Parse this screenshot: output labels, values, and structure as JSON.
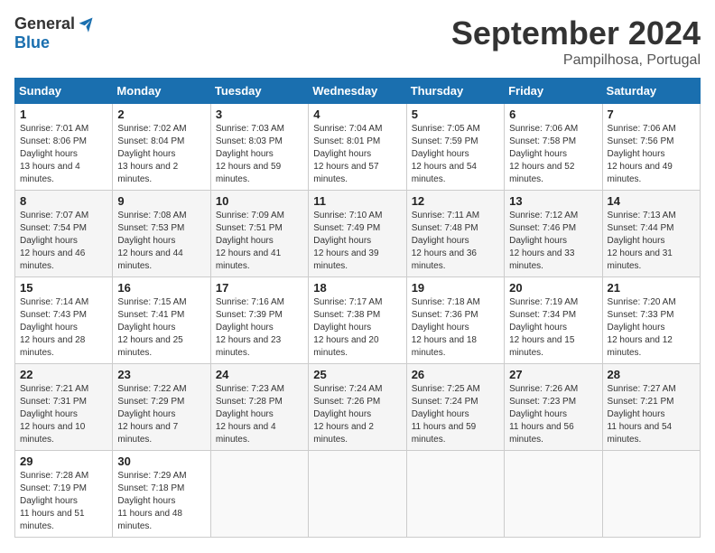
{
  "header": {
    "logo_general": "General",
    "logo_blue": "Blue",
    "month_title": "September 2024",
    "location": "Pampilhosa, Portugal"
  },
  "calendar": {
    "days_of_week": [
      "Sunday",
      "Monday",
      "Tuesday",
      "Wednesday",
      "Thursday",
      "Friday",
      "Saturday"
    ],
    "weeks": [
      [
        null,
        null,
        null,
        null,
        {
          "day": 1,
          "sunrise": "7:01 AM",
          "sunset": "8:06 PM",
          "daylight": "13 hours and 4 minutes."
        },
        {
          "day": 2,
          "sunrise": "7:02 AM",
          "sunset": "8:04 PM",
          "daylight": "13 hours and 2 minutes."
        },
        {
          "day": 3,
          "sunrise": "7:03 AM",
          "sunset": "8:03 PM",
          "daylight": "12 hours and 59 minutes."
        },
        {
          "day": 4,
          "sunrise": "7:04 AM",
          "sunset": "8:01 PM",
          "daylight": "12 hours and 57 minutes."
        },
        {
          "day": 5,
          "sunrise": "7:05 AM",
          "sunset": "7:59 PM",
          "daylight": "12 hours and 54 minutes."
        },
        {
          "day": 6,
          "sunrise": "7:06 AM",
          "sunset": "7:58 PM",
          "daylight": "12 hours and 52 minutes."
        },
        {
          "day": 7,
          "sunrise": "7:06 AM",
          "sunset": "7:56 PM",
          "daylight": "12 hours and 49 minutes."
        }
      ],
      [
        {
          "day": 8,
          "sunrise": "7:07 AM",
          "sunset": "7:54 PM",
          "daylight": "12 hours and 46 minutes."
        },
        {
          "day": 9,
          "sunrise": "7:08 AM",
          "sunset": "7:53 PM",
          "daylight": "12 hours and 44 minutes."
        },
        {
          "day": 10,
          "sunrise": "7:09 AM",
          "sunset": "7:51 PM",
          "daylight": "12 hours and 41 minutes."
        },
        {
          "day": 11,
          "sunrise": "7:10 AM",
          "sunset": "7:49 PM",
          "daylight": "12 hours and 39 minutes."
        },
        {
          "day": 12,
          "sunrise": "7:11 AM",
          "sunset": "7:48 PM",
          "daylight": "12 hours and 36 minutes."
        },
        {
          "day": 13,
          "sunrise": "7:12 AM",
          "sunset": "7:46 PM",
          "daylight": "12 hours and 33 minutes."
        },
        {
          "day": 14,
          "sunrise": "7:13 AM",
          "sunset": "7:44 PM",
          "daylight": "12 hours and 31 minutes."
        }
      ],
      [
        {
          "day": 15,
          "sunrise": "7:14 AM",
          "sunset": "7:43 PM",
          "daylight": "12 hours and 28 minutes."
        },
        {
          "day": 16,
          "sunrise": "7:15 AM",
          "sunset": "7:41 PM",
          "daylight": "12 hours and 25 minutes."
        },
        {
          "day": 17,
          "sunrise": "7:16 AM",
          "sunset": "7:39 PM",
          "daylight": "12 hours and 23 minutes."
        },
        {
          "day": 18,
          "sunrise": "7:17 AM",
          "sunset": "7:38 PM",
          "daylight": "12 hours and 20 minutes."
        },
        {
          "day": 19,
          "sunrise": "7:18 AM",
          "sunset": "7:36 PM",
          "daylight": "12 hours and 18 minutes."
        },
        {
          "day": 20,
          "sunrise": "7:19 AM",
          "sunset": "7:34 PM",
          "daylight": "12 hours and 15 minutes."
        },
        {
          "day": 21,
          "sunrise": "7:20 AM",
          "sunset": "7:33 PM",
          "daylight": "12 hours and 12 minutes."
        }
      ],
      [
        {
          "day": 22,
          "sunrise": "7:21 AM",
          "sunset": "7:31 PM",
          "daylight": "12 hours and 10 minutes."
        },
        {
          "day": 23,
          "sunrise": "7:22 AM",
          "sunset": "7:29 PM",
          "daylight": "12 hours and 7 minutes."
        },
        {
          "day": 24,
          "sunrise": "7:23 AM",
          "sunset": "7:28 PM",
          "daylight": "12 hours and 4 minutes."
        },
        {
          "day": 25,
          "sunrise": "7:24 AM",
          "sunset": "7:26 PM",
          "daylight": "12 hours and 2 minutes."
        },
        {
          "day": 26,
          "sunrise": "7:25 AM",
          "sunset": "7:24 PM",
          "daylight": "11 hours and 59 minutes."
        },
        {
          "day": 27,
          "sunrise": "7:26 AM",
          "sunset": "7:23 PM",
          "daylight": "11 hours and 56 minutes."
        },
        {
          "day": 28,
          "sunrise": "7:27 AM",
          "sunset": "7:21 PM",
          "daylight": "11 hours and 54 minutes."
        }
      ],
      [
        {
          "day": 29,
          "sunrise": "7:28 AM",
          "sunset": "7:19 PM",
          "daylight": "11 hours and 51 minutes."
        },
        {
          "day": 30,
          "sunrise": "7:29 AM",
          "sunset": "7:18 PM",
          "daylight": "11 hours and 48 minutes."
        },
        null,
        null,
        null,
        null,
        null
      ]
    ]
  }
}
